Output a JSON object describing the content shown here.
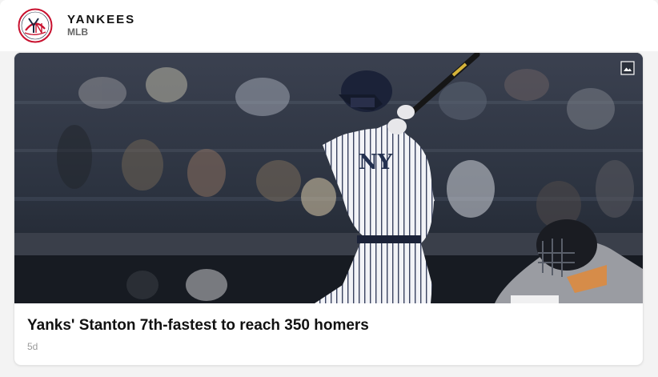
{
  "header": {
    "team_name": "YANKEES",
    "league": "MLB",
    "logo_icon": "yankees-logo-icon",
    "brand_color": "#c8102e"
  },
  "article": {
    "headline": "Yanks' Stanton 7th-fastest to reach 350 homers",
    "age": "5d",
    "image_icon": "gallery-icon"
  }
}
